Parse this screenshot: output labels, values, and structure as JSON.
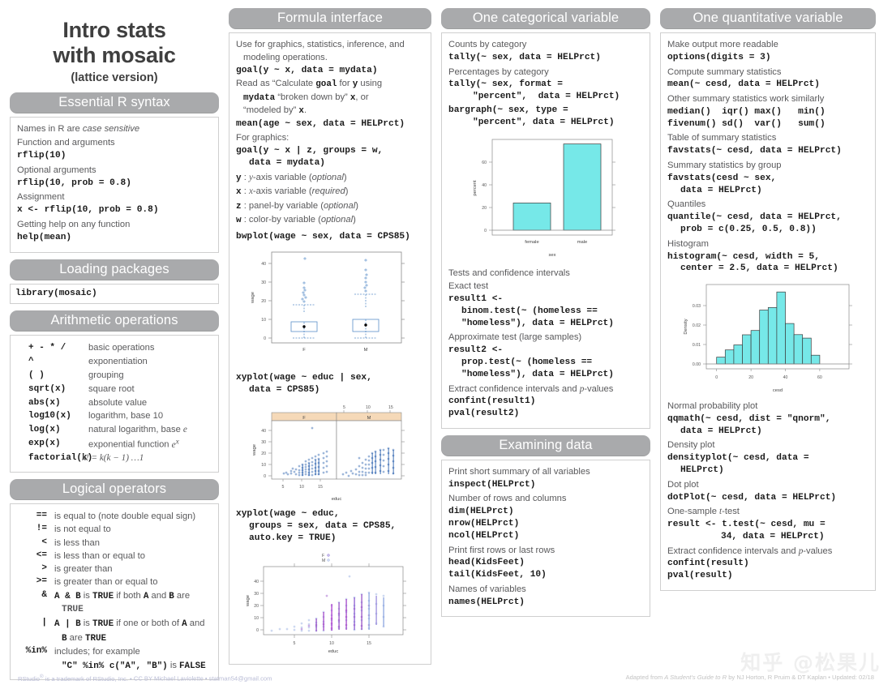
{
  "title": {
    "line1": "Intro stats",
    "line2": "with mosaic",
    "subtitle": "(lattice version)"
  },
  "colors": {
    "header_gray": "#a9aaac",
    "cyan": "#76e8e8",
    "blue": "#4472c4",
    "panel_strip": "#f5d9b8"
  },
  "sections": {
    "essential_r_syntax": {
      "header": "Essential R syntax",
      "lines": [
        {
          "type": "desc",
          "text": "Names in R are ",
          "em": "case sensitive"
        },
        {
          "type": "desc",
          "text": "Function and arguments"
        },
        {
          "type": "code",
          "text": "rflip(10)"
        },
        {
          "type": "desc",
          "text": "Optional arguments"
        },
        {
          "type": "code",
          "text": "rflip(10, prob = 0.8)"
        },
        {
          "type": "desc",
          "text": "Assignment"
        },
        {
          "type": "code",
          "text": "x <- rflip(10, prob = 0.8)"
        },
        {
          "type": "desc",
          "text": "Getting help on any function"
        },
        {
          "type": "code",
          "text": "help(mean)"
        }
      ]
    },
    "loading_packages": {
      "header": "Loading packages",
      "code": "library(mosaic)"
    },
    "arithmetic_operations": {
      "header": "Arithmetic operations",
      "rows": [
        {
          "op": "+   -   *   /",
          "meaning": "basic operations"
        },
        {
          "op": "^",
          "meaning": "exponentiation"
        },
        {
          "op": "( )",
          "meaning": "grouping"
        },
        {
          "op": "sqrt(x)",
          "meaning": "square root"
        },
        {
          "op": "abs(x)",
          "meaning": "absolute value"
        },
        {
          "op": "log10(x)",
          "meaning": "logarithm, base 10"
        },
        {
          "op": "log(x)",
          "meaning": "natural logarithm, base e"
        },
        {
          "op": "exp(x)",
          "meaning": "exponential function e^x"
        },
        {
          "op": "factorial(k)",
          "meaning": "k! = k(k − 1) …1"
        }
      ]
    },
    "logical_operators": {
      "header": "Logical operators",
      "rows": [
        {
          "op": "==",
          "meaning": "is equal to (note double equal sign)"
        },
        {
          "op": "!=",
          "meaning": "is not equal to"
        },
        {
          "op": "<",
          "meaning": "is less than"
        },
        {
          "op": "<=",
          "meaning": "is less than or equal to"
        },
        {
          "op": ">",
          "meaning": "is greater than"
        },
        {
          "op": ">=",
          "meaning": "is greater than or equal to"
        },
        {
          "op": "&",
          "meaning": "A & B is TRUE if both A and B are",
          "cont": "TRUE"
        },
        {
          "op": "|",
          "meaning": "A | B is TRUE if one or both of A and",
          "cont": "B are TRUE"
        },
        {
          "op": "%in%",
          "meaning": "includes; for example",
          "cont": "\"C\" %in% c(\"A\", \"B\") is FALSE"
        }
      ]
    },
    "formula_interface": {
      "header": "Formula interface",
      "intro1": "Use for graphics, statistics, inference, and",
      "intro2": "modeling operations.",
      "code1": "goal(y ~ x, data = mydata)",
      "read1": "Read as “Calculate goal for y using",
      "read2": "mydata “broken down by” x, or",
      "read3": "“modeled by” x.",
      "code2": "mean(age ~ sex, data = HELPrct)",
      "for_graphics": "For graphics:",
      "code3a": "goal(y ~ x | z, groups = w,",
      "code3b": "data = mydata)",
      "vars": [
        {
          "sym": "y",
          "desc": " : y-axis variable (optional)"
        },
        {
          "sym": "x",
          "desc": " : x-axis variable (required)"
        },
        {
          "sym": "z",
          "desc": " : panel-by variable (optional)"
        },
        {
          "sym": "w",
          "desc": " : color-by variable (optional)"
        }
      ],
      "code4": "bwplot(wage ~ sex, data = CPS85)",
      "code5a": "xyplot(wage ~ educ | sex,",
      "code5b": "data = CPS85)",
      "code6a": "xyplot(wage ~ educ,",
      "code6b": "groups = sex, data = CPS85,",
      "code6c": "auto.key = TRUE)"
    },
    "one_categorical": {
      "header": "One categorical variable",
      "lines": [
        {
          "type": "desc",
          "text": "Counts by category"
        },
        {
          "type": "code",
          "text": "tally(~ sex, data = HELPrct)"
        },
        {
          "type": "desc",
          "text": "Percentages by category"
        },
        {
          "type": "code",
          "text": "tally(~ sex, format ="
        },
        {
          "type": "code",
          "indent": 2,
          "text": "\"percent\",  data = HELPrct)"
        },
        {
          "type": "code",
          "text": "bargraph(~ sex, type ="
        },
        {
          "type": "code",
          "indent": 2,
          "text": "\"percent\", data = HELPrct)"
        }
      ],
      "after_plot": [
        {
          "type": "desc",
          "text": "Tests and confidence intervals"
        },
        {
          "type": "desc",
          "text": "Exact test"
        },
        {
          "type": "code",
          "text": "result1 <-"
        },
        {
          "type": "code",
          "indent": 1,
          "text": "binom.test(~ (homeless =="
        },
        {
          "type": "code",
          "indent": 1,
          "text": "\"homeless\"), data = HELPrct)"
        },
        {
          "type": "desc",
          "text": "Approximate test (large samples)"
        },
        {
          "type": "code",
          "text": "result2 <-"
        },
        {
          "type": "code",
          "indent": 1,
          "text": "prop.test(~ (homeless =="
        },
        {
          "type": "code",
          "indent": 1,
          "text": "\"homeless\"), data = HELPrct)"
        },
        {
          "type": "desc",
          "text": "Extract confidence intervals and p-values"
        },
        {
          "type": "code",
          "text": "confint(result1)"
        },
        {
          "type": "code",
          "text": "pval(result2)"
        }
      ]
    },
    "examining_data": {
      "header": "Examining data",
      "lines": [
        {
          "type": "desc",
          "text": "Print short summary of all variables"
        },
        {
          "type": "code",
          "text": "inspect(HELPrct)"
        },
        {
          "type": "desc",
          "text": "Number of rows and columns"
        },
        {
          "type": "code",
          "text": "dim(HELPrct)"
        },
        {
          "type": "code",
          "text": "nrow(HELPrct)"
        },
        {
          "type": "code",
          "text": "ncol(HELPrct)"
        },
        {
          "type": "desc",
          "text": "Print first rows or last rows"
        },
        {
          "type": "code",
          "text": "head(KidsFeet)"
        },
        {
          "type": "code",
          "text": "tail(KidsFeet, 10)"
        },
        {
          "type": "desc",
          "text": "Names of variables"
        },
        {
          "type": "code",
          "text": "names(HELPrct)"
        }
      ]
    },
    "one_quantitative": {
      "header": "One quantitative variable",
      "lines": [
        {
          "type": "desc",
          "text": "Make output more readable"
        },
        {
          "type": "code",
          "text": "options(digits = 3)"
        },
        {
          "type": "desc",
          "text": "Compute summary statistics"
        },
        {
          "type": "code",
          "text": "mean(~ cesd, data = HELPrct)"
        },
        {
          "type": "desc",
          "text": "Other summary statistics work similarly"
        },
        {
          "type": "code",
          "text": "median()  iqr() max()   min()"
        },
        {
          "type": "code",
          "text": "fivenum() sd()  var()   sum()"
        },
        {
          "type": "desc",
          "text": "Table of  summary statistics"
        },
        {
          "type": "code",
          "text": "favstats(~ cesd, data = HELPrct)"
        },
        {
          "type": "desc",
          "text": "Summary statistics by group"
        },
        {
          "type": "code",
          "text": "favstats(cesd ~ sex,"
        },
        {
          "type": "code",
          "indent": 1,
          "text": "data = HELPrct)"
        },
        {
          "type": "desc",
          "text": "Quantiles"
        },
        {
          "type": "code",
          "text": "quantile(~ cesd, data = HELPrct,"
        },
        {
          "type": "code",
          "indent": 1,
          "text": "prob = c(0.25, 0.5, 0.8))"
        },
        {
          "type": "desc",
          "text": "Histogram"
        },
        {
          "type": "code",
          "text": "histogram(~ cesd, width = 5,"
        },
        {
          "type": "code",
          "indent": 1,
          "text": "center = 2.5, data = HELPrct)"
        }
      ],
      "after_plot": [
        {
          "type": "desc",
          "text": "Normal probability plot"
        },
        {
          "type": "code",
          "text": "qqmath(~ cesd, dist = \"qnorm\","
        },
        {
          "type": "code",
          "indent": 1,
          "text": "data = HELPrct)"
        },
        {
          "type": "desc",
          "text": "Density plot"
        },
        {
          "type": "code",
          "text": "densityplot(~ cesd, data ="
        },
        {
          "type": "code",
          "indent": 1,
          "text": "HELPrct)"
        },
        {
          "type": "desc",
          "text": "Dot plot"
        },
        {
          "type": "code",
          "text": "dotPlot(~ cesd, data = HELPrct)"
        },
        {
          "type": "desc",
          "text": "One-sample t-test"
        },
        {
          "type": "code",
          "text": "result <- t.test(~ cesd, mu ="
        },
        {
          "type": "code",
          "indent": 3,
          "text": "34, data = HELPrct)"
        },
        {
          "type": "desc",
          "text": "Extract confidence intervals and p-values"
        },
        {
          "type": "code",
          "text": "confint(result)"
        },
        {
          "type": "code",
          "text": "pval(result)"
        }
      ]
    }
  },
  "chart_data": [
    {
      "id": "bwplot-wage-sex",
      "type": "boxplot",
      "title": "",
      "xlabel": "",
      "ylabel": "wage",
      "categories": [
        "F",
        "M"
      ],
      "yticks": [
        0,
        10,
        20,
        30,
        40
      ],
      "ylim": [
        -3,
        47
      ],
      "boxes": [
        {
          "category": "F",
          "min": 1.0,
          "q1": 4.2,
          "median": 5.8,
          "q3": 8.5,
          "max": 14.0,
          "outliers": [
            15.5,
            16.2,
            17.0,
            18.0,
            19.5,
            21.0,
            23.0,
            25.0,
            44.5
          ]
        },
        {
          "category": "M",
          "min": 1.2,
          "q1": 5.2,
          "median": 7.6,
          "q3": 11.2,
          "max": 19.5,
          "outliers": [
            20.5,
            22.0,
            24.0,
            26.0,
            28.0,
            30.0,
            32.0,
            34.0,
            38.0,
            44.0
          ]
        }
      ]
    },
    {
      "id": "xyplot-wage-educ-by-sex",
      "type": "scatter",
      "xlabel": "educ",
      "ylabel": "wage",
      "panels": [
        "F",
        "M"
      ],
      "xticks": [
        5,
        10,
        15
      ],
      "yticks": [
        0,
        10,
        20,
        30,
        40
      ],
      "xlim": [
        1,
        19
      ],
      "ylim": [
        -3,
        47
      ]
    },
    {
      "id": "bargraph-sex-percent",
      "type": "bar",
      "categories": [
        "female",
        "male"
      ],
      "values": [
        24,
        76
      ],
      "xlabel": "sex",
      "ylabel": "percent",
      "yticks": [
        0,
        20,
        40,
        60
      ],
      "ylim": [
        0,
        82
      ]
    },
    {
      "id": "xyplot-wage-educ-groups-sex",
      "type": "scatter",
      "xlabel": "educ",
      "ylabel": "wage",
      "legend": [
        "F",
        "M"
      ],
      "legend_position": "top",
      "xticks": [
        5,
        10,
        15
      ],
      "yticks": [
        0,
        10,
        20,
        30,
        40
      ],
      "xlim": [
        1,
        19
      ],
      "ylim": [
        -3,
        47
      ]
    },
    {
      "id": "histogram-cesd",
      "type": "histogram",
      "xlabel": "cesd",
      "ylabel": "Density",
      "xticks": [
        0,
        20,
        40,
        60
      ],
      "yticks": [
        0.0,
        0.01,
        0.02,
        0.03
      ],
      "xlim": [
        -4,
        66
      ],
      "ylim": [
        0,
        0.039
      ],
      "bin_width": 5,
      "bin_centers": [
        2.5,
        7.5,
        12.5,
        17.5,
        22.5,
        27.5,
        32.5,
        37.5,
        42.5,
        47.5,
        52.5,
        57.5
      ],
      "densities": [
        0.0035,
        0.0072,
        0.0098,
        0.015,
        0.0172,
        0.0277,
        0.029,
        0.037,
        0.0208,
        0.0151,
        0.0133,
        0.0045
      ]
    }
  ],
  "footer": {
    "left_plain": "RStudio",
    "left_sup": "®",
    "left_rest": " is a trademark of RStudio, Inc.  •  ",
    "left_link": "CC BY Michael Laviolette • statman54@gmail.com",
    "right_prefix": "Adapted from ",
    "right_italic": "A Student’s Guide to R",
    "right_suffix": " by NJ Horton, R Pruim & DT Kaplan • Updated: 02/18"
  },
  "watermark": "知乎 @松果儿"
}
